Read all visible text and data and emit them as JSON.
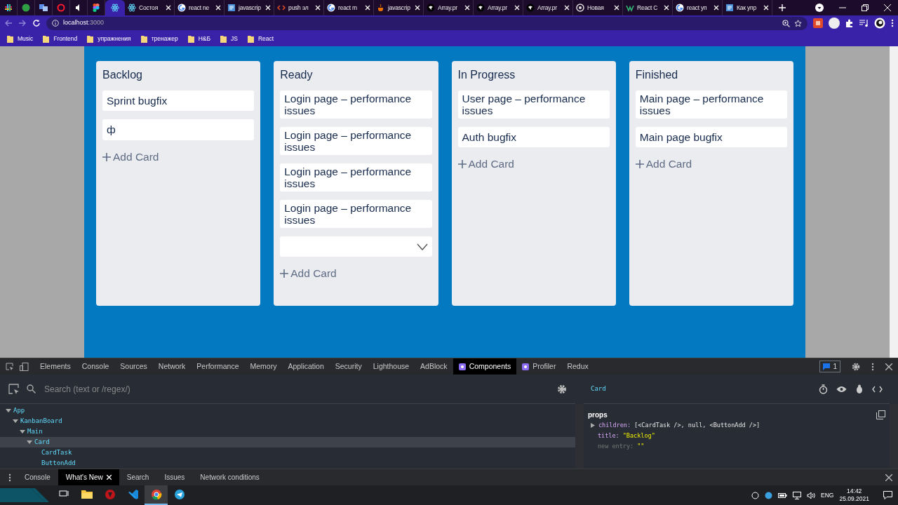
{
  "browser": {
    "tabs": [
      {
        "kind": "pinned",
        "selected": false
      },
      {
        "kind": "pinned",
        "selected": false
      },
      {
        "kind": "pinned",
        "selected": false
      },
      {
        "kind": "pinned",
        "selected": false
      },
      {
        "kind": "pinned",
        "selected": false
      },
      {
        "kind": "pinned",
        "selected": false
      },
      {
        "kind": "pinned",
        "selected": true
      },
      {
        "kind": "page",
        "title": "Состоя",
        "selected": false
      },
      {
        "kind": "page",
        "title": "react ne",
        "selected": false
      },
      {
        "kind": "page",
        "title": "javascrip",
        "selected": false
      },
      {
        "kind": "page",
        "title": "push эл",
        "selected": false
      },
      {
        "kind": "page",
        "title": "react m",
        "selected": false
      },
      {
        "kind": "page",
        "title": "javascrip",
        "selected": false
      },
      {
        "kind": "page",
        "title": "Array.pr",
        "selected": false
      },
      {
        "kind": "page",
        "title": "Array.pr",
        "selected": false
      },
      {
        "kind": "page",
        "title": "Array.pr",
        "selected": false
      },
      {
        "kind": "page",
        "title": "Новая",
        "selected": false
      },
      {
        "kind": "page",
        "title": "React C",
        "selected": false
      },
      {
        "kind": "page",
        "title": "react уп",
        "selected": false
      },
      {
        "kind": "page",
        "title": "Как упр",
        "selected": false
      }
    ],
    "url_host": "localhost",
    "url_port": ":3000",
    "bookmarks": [
      "Music",
      "Frontend",
      "упражнения",
      "тренажер",
      "H&Б",
      "JS",
      "React"
    ]
  },
  "board": {
    "columns": [
      {
        "title": "Backlog",
        "cards": [
          {
            "kind": "text",
            "text": "Sprint bugfix"
          },
          {
            "kind": "input",
            "value": "ф"
          }
        ],
        "add_label": "Add Card"
      },
      {
        "title": "Ready",
        "cards": [
          {
            "kind": "text",
            "text": "Login page – performance issues"
          },
          {
            "kind": "text",
            "text": "Login page – performance issues"
          },
          {
            "kind": "text",
            "text": "Login page – performance issues"
          },
          {
            "kind": "text",
            "text": "Login page – performance issues"
          },
          {
            "kind": "select"
          }
        ],
        "add_label": "Add Card"
      },
      {
        "title": "In Progress",
        "cards": [
          {
            "kind": "text",
            "text": "User page – performance issues"
          },
          {
            "kind": "text",
            "text": "Auth bugfix"
          }
        ],
        "add_label": "Add Card"
      },
      {
        "title": "Finished",
        "cards": [
          {
            "kind": "text",
            "text": "Main page – performance issues"
          },
          {
            "kind": "text",
            "text": "Main page bugfix"
          }
        ],
        "add_label": "Add Card"
      }
    ]
  },
  "devtools": {
    "tabs": [
      {
        "label": "Elements",
        "selected": false
      },
      {
        "label": "Console",
        "selected": false
      },
      {
        "label": "Sources",
        "selected": false
      },
      {
        "label": "Network",
        "selected": false
      },
      {
        "label": "Performance",
        "selected": false
      },
      {
        "label": "Memory",
        "selected": false
      },
      {
        "label": "Application",
        "selected": false
      },
      {
        "label": "Security",
        "selected": false
      },
      {
        "label": "Lighthouse",
        "selected": false
      },
      {
        "label": "AdBlock",
        "selected": false
      },
      {
        "label": "Components",
        "react": true,
        "selected": true
      },
      {
        "label": "Profiler",
        "react": true,
        "selected": false
      },
      {
        "label": "Redux",
        "selected": false
      }
    ],
    "issues_count": "1",
    "search": {
      "placeholder": "Search (text or /regex/)"
    },
    "tree": [
      {
        "name": "App",
        "expanded": true,
        "selected": false,
        "children": [
          {
            "name": "KanbanBoard",
            "expanded": true,
            "selected": false,
            "children": [
              {
                "name": "Main",
                "expanded": true,
                "selected": false,
                "children": [
                  {
                    "name": "Card",
                    "expanded": true,
                    "selected": true,
                    "children": [
                      {
                        "name": "CardTask",
                        "selected": false
                      },
                      {
                        "name": "ButtonAdd",
                        "selected": false
                      }
                    ]
                  }
                ]
              }
            ]
          }
        ]
      }
    ],
    "selected_component": "Card",
    "props_title": "props",
    "props": [
      {
        "kind": "expandable",
        "key": "children:",
        "value": "[<CardTask />, null, <ButtonAdd />]"
      },
      {
        "kind": "string",
        "key": "title:",
        "value": "\"Backlog\""
      },
      {
        "kind": "new",
        "key": "new entry:",
        "value": "\"\""
      }
    ],
    "drawer_tabs": [
      {
        "label": "Console",
        "selected": false
      },
      {
        "label": "What's New",
        "selected": true
      },
      {
        "label": "Search",
        "selected": false
      },
      {
        "label": "Issues",
        "selected": false
      },
      {
        "label": "Network conditions",
        "selected": false
      }
    ]
  },
  "taskbar": {
    "apps": [
      {
        "active": false
      },
      {
        "active": false
      },
      {
        "active": false
      },
      {
        "active": false
      },
      {
        "active": true
      },
      {
        "active": false
      }
    ],
    "language": "ENG",
    "time": "14:42",
    "date": "25.09.2021"
  }
}
